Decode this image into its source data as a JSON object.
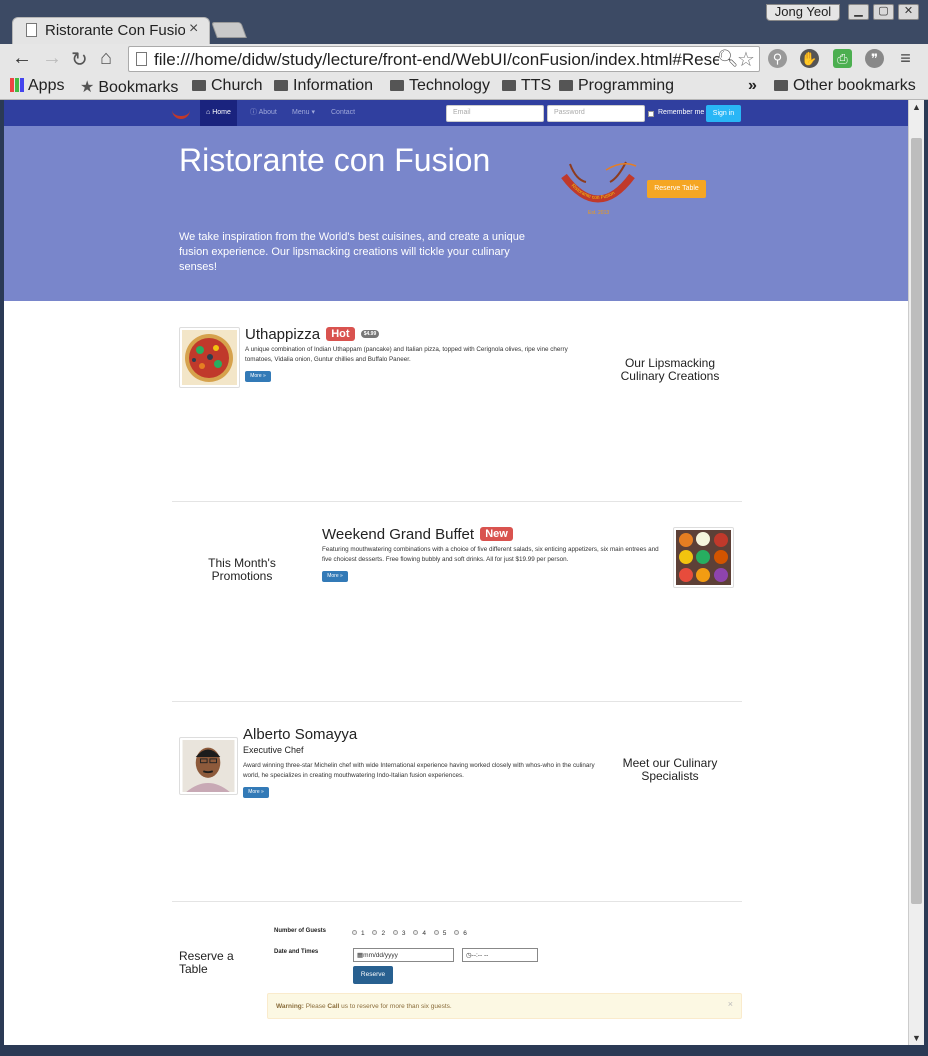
{
  "browser": {
    "tab_title": "Ristorante Con Fusio",
    "tab_close": "×",
    "user_name": "Jong Yeol",
    "address": "file:///home/didw/study/lecture/front-end/WebUI/conFusion/index.html#Rese",
    "bookmarks": [
      {
        "label": "Apps"
      },
      {
        "label": "Bookmarks"
      },
      {
        "label": "Church"
      },
      {
        "label": "Information"
      },
      {
        "label": "Technology"
      },
      {
        "label": "TTS"
      },
      {
        "label": "Programming"
      }
    ],
    "overflow_chevron": "»",
    "other_bookmarks": "Other bookmarks"
  },
  "navbar": {
    "home": "Home",
    "about": "About",
    "menu": "Menu ▾",
    "contact": "Contact",
    "email_placeholder": "Email",
    "password_placeholder": "Password",
    "remember": "Remember me",
    "signin": "Sign in"
  },
  "jumbotron": {
    "title": "Ristorante con Fusion",
    "text": "We take inspiration from the World's best cuisines, and create a unique fusion experience. Our lipsmacking creations will tickle your culinary senses!",
    "reserve_button": "Reserve Table",
    "logo_text": "Ristorante con Fusion",
    "logo_est": "Est. 2013"
  },
  "dish": {
    "name": "Uthappizza",
    "badge": "Hot",
    "price": "$4.99",
    "description": "A unique combination of Indian Uthappam (pancake) and Italian pizza, topped with Cerignola olives, ripe vine cherry tomatoes, Vidalia onion, Guntur chillies and Buffalo Paneer.",
    "more": "More »",
    "side_heading": "Our Lipsmacking Culinary Creations"
  },
  "promotion": {
    "name": "Weekend Grand Buffet",
    "badge": "New",
    "description": "Featuring mouthwatering combinations with a choice of five different salads, six enticing appetizers, six main entrees and five choicest desserts. Free flowing bubbly and soft drinks. All for just $19.99 per person.",
    "more": "More »",
    "side_heading": "This Month's Promotions"
  },
  "leader": {
    "name": "Alberto Somayya",
    "role": "Executive Chef",
    "description": "Award winning three-star Michelin chef with wide International experience having worked closely with whos-who in the culinary world, he specializes in creating mouthwatering Indo-Italian fusion experiences.",
    "more": "More »",
    "side_heading": "Meet our Culinary Specialists"
  },
  "reservation": {
    "heading": "Reserve a Table",
    "guests_label": "Number of Guests",
    "guest_options": [
      "1",
      "2",
      "3",
      "4",
      "5",
      "6"
    ],
    "datetime_label": "Date and Times",
    "date_placeholder": "mm/dd/yyyy",
    "time_placeholder": "--:-- --",
    "submit": "Reserve",
    "alert_strong": "Warning:",
    "alert_pre": " Please ",
    "alert_call": "Call",
    "alert_post": " us to reserve for more than six guests.",
    "alert_close": "×"
  },
  "colors": {
    "navbar": "#303f9f",
    "jumbotron": "#7986cb",
    "reserve_button": "#f5a623",
    "signin_button": "#29b6f6",
    "badge_red": "#d9534f"
  }
}
